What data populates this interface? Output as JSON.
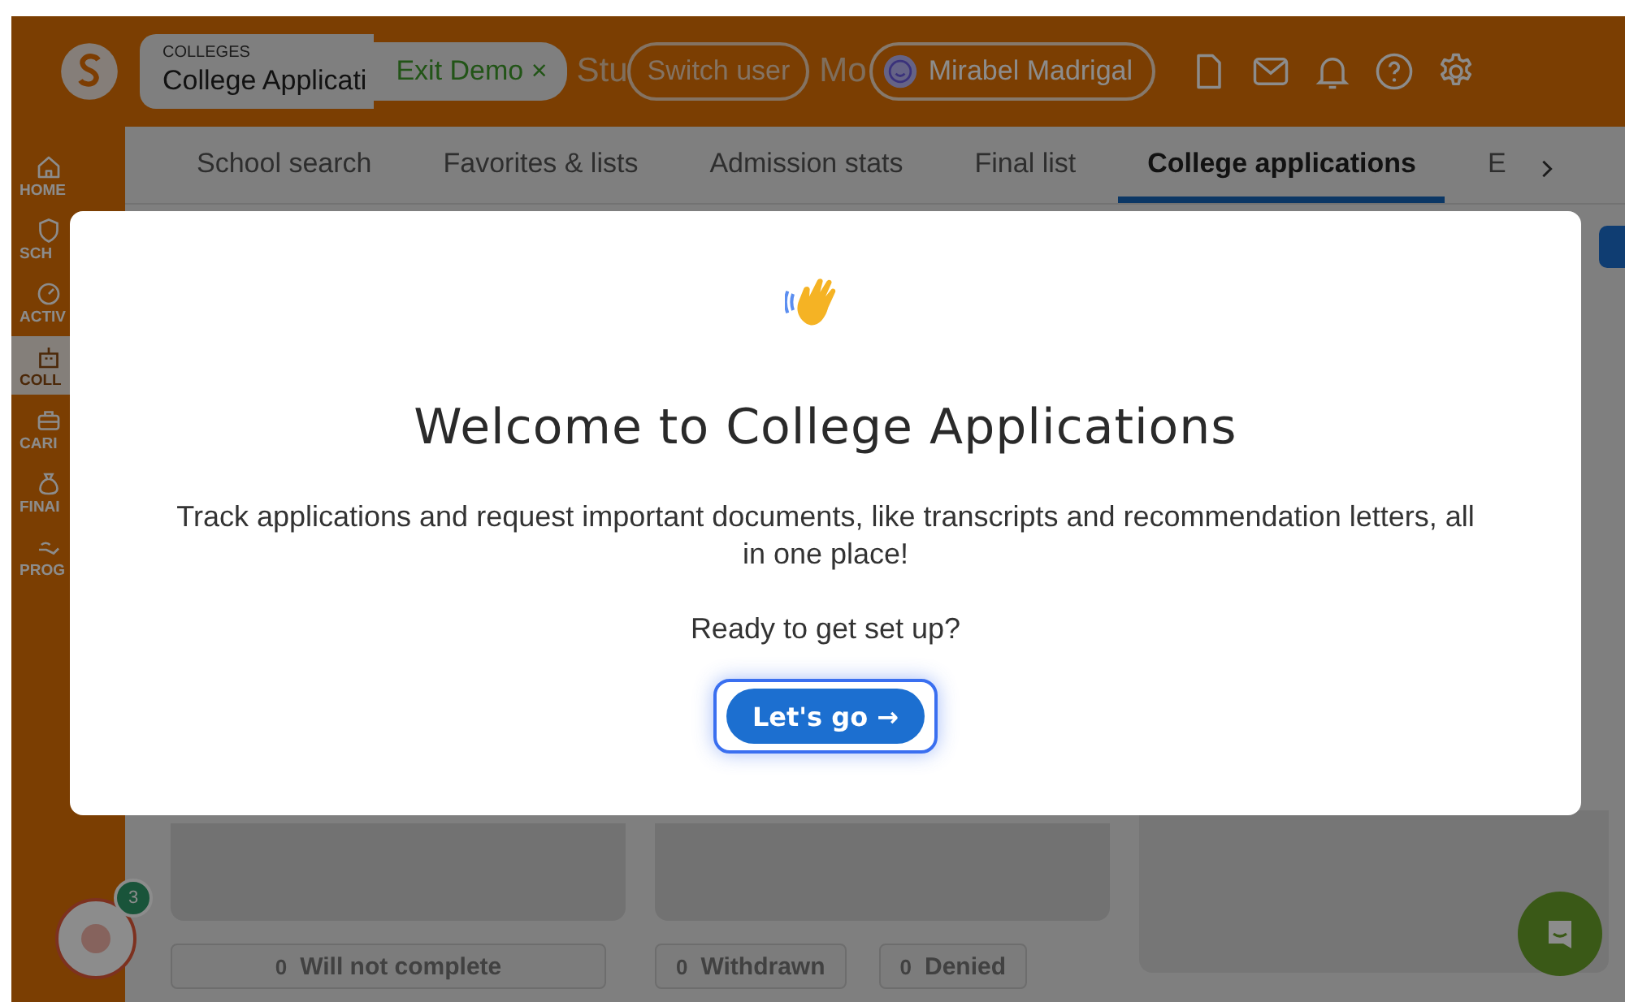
{
  "header": {
    "breadcrumb": {
      "section": "COLLEGES",
      "title": "College Applicati"
    },
    "exit_demo": "Exit Demo ×",
    "fragment_left": "Stu",
    "switch_pill": "Switch user",
    "fragment_right": "Mo",
    "user": {
      "name": "Mirabel Madrigal"
    }
  },
  "sidebar": {
    "items": [
      {
        "label": "HOME",
        "selected": false
      },
      {
        "label": "SCH",
        "selected": false
      },
      {
        "label": "ACTIV",
        "selected": false
      },
      {
        "label": "COLL",
        "selected": true
      },
      {
        "label": "CARI",
        "selected": false
      },
      {
        "label": "FINAI",
        "selected": false
      },
      {
        "label": "PROG",
        "selected": false
      }
    ]
  },
  "tabs": [
    {
      "label": "School search",
      "selected": false
    },
    {
      "label": "Favorites & lists",
      "selected": false
    },
    {
      "label": "Admission stats",
      "selected": false
    },
    {
      "label": "Final list",
      "selected": false
    },
    {
      "label": "College applications",
      "selected": true
    },
    {
      "label": "E",
      "selected": false
    }
  ],
  "status_chips": [
    {
      "count": "0",
      "label": "Will not complete"
    },
    {
      "count": "0",
      "label": "Withdrawn"
    },
    {
      "count": "0",
      "label": "Denied"
    }
  ],
  "helper": {
    "badge": "3"
  },
  "modal": {
    "title": "Welcome to College Applications",
    "body": "Track applications and request important documents, like transcripts and recommendation letters, all in one place!",
    "prompt": "Ready to get set up?",
    "button": "Let's go →"
  }
}
